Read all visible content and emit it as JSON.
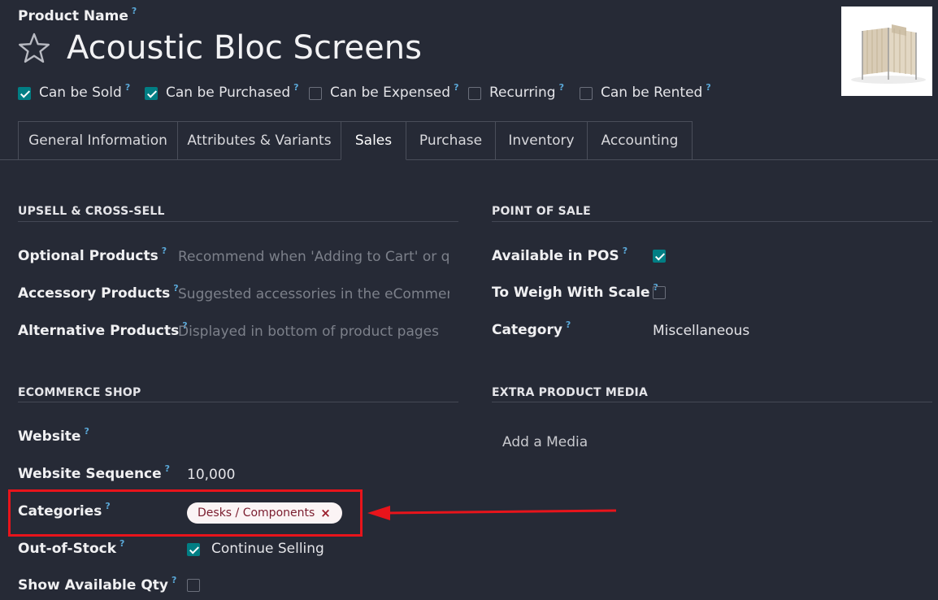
{
  "header": {
    "field_label": "Product Name",
    "help_mark": "?",
    "title": "Acoustic Bloc Screens"
  },
  "options": [
    {
      "label": "Can be Sold",
      "checked": true
    },
    {
      "label": "Can be Purchased",
      "checked": true
    },
    {
      "label": "Can be Expensed",
      "checked": false
    },
    {
      "label": "Recurring",
      "checked": false
    },
    {
      "label": "Can be Rented",
      "checked": false
    }
  ],
  "tabs": [
    {
      "label": "General Information"
    },
    {
      "label": "Attributes & Variants"
    },
    {
      "label": "Sales",
      "active": true
    },
    {
      "label": "Purchase"
    },
    {
      "label": "Inventory"
    },
    {
      "label": "Accounting"
    }
  ],
  "upsell": {
    "heading": "UPSELL & CROSS-SELL",
    "optional_label": "Optional Products",
    "optional_placeholder": "Recommend when 'Adding to Cart' or quot",
    "accessory_label": "Accessory Products",
    "accessory_placeholder": "Suggested accessories in the eCommerce c",
    "alternative_label": "Alternative Products",
    "alternative_placeholder": "Displayed in bottom of product pages"
  },
  "pos": {
    "heading": "POINT OF SALE",
    "available_label": "Available in POS",
    "available_checked": true,
    "weigh_label": "To Weigh With Scale",
    "weigh_checked": false,
    "category_label": "Category",
    "category_value": "Miscellaneous"
  },
  "ecommerce": {
    "heading": "ECOMMERCE SHOP",
    "website_label": "Website",
    "sequence_label": "Website Sequence",
    "sequence_value": "10,000",
    "categories_label": "Categories",
    "category_tag": "Desks / Components",
    "tag_remove": "×",
    "oos_label": "Out-of-Stock",
    "oos_option": "Continue Selling",
    "oos_checked": true,
    "qty_label": "Show Available Qty",
    "qty_checked": false
  },
  "media": {
    "heading": "EXTRA PRODUCT MEDIA",
    "add_label": "Add a Media"
  },
  "colors": {
    "accent": "#017e84",
    "highlight": "#e8141b",
    "tag_text": "#7a1c2e"
  }
}
